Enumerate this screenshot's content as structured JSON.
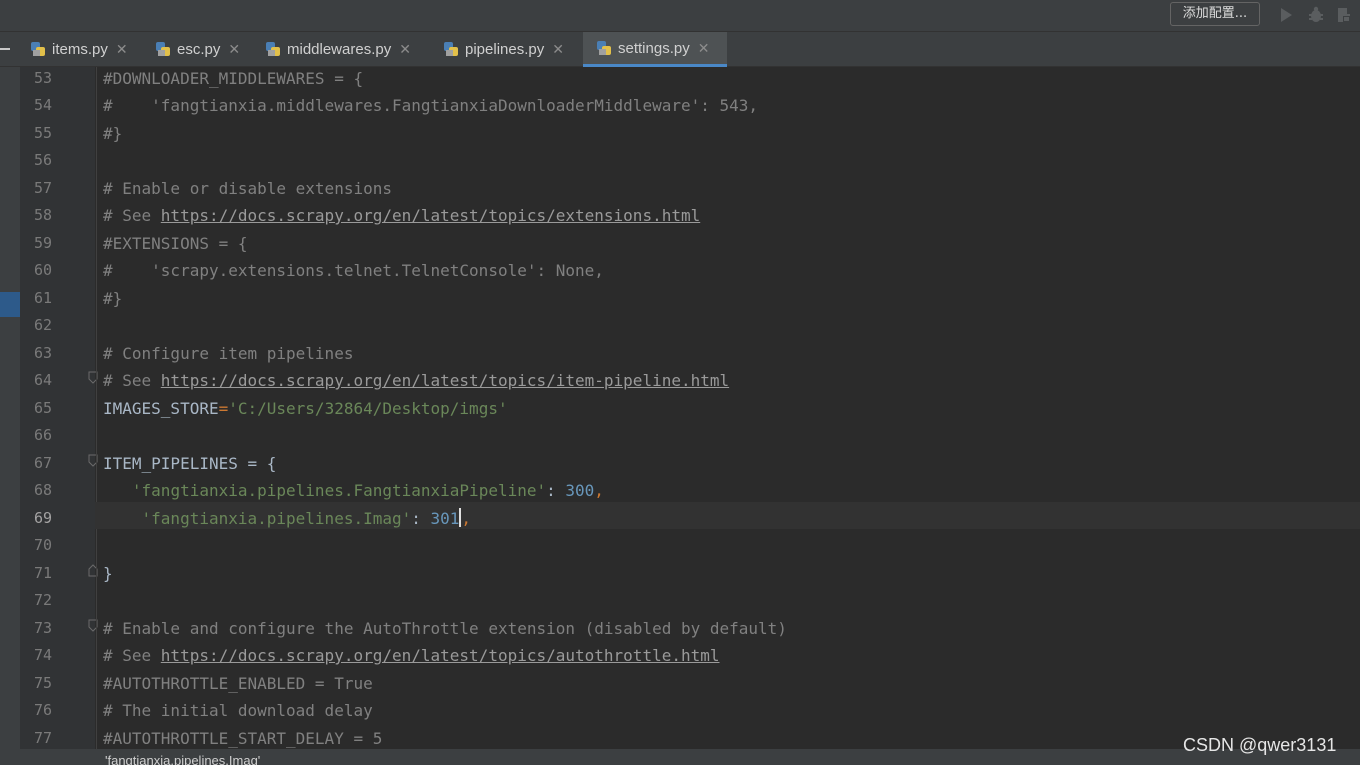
{
  "toolbar": {
    "config_button": "添加配置...",
    "icons": [
      "run-icon",
      "debug-icon",
      "coverage-icon"
    ]
  },
  "tabs": [
    {
      "label": "items.py",
      "active": false
    },
    {
      "label": "esc.py",
      "active": false
    },
    {
      "label": "middlewares.py",
      "active": false
    },
    {
      "label": "pipelines.py",
      "active": false
    },
    {
      "label": "settings.py",
      "active": true
    }
  ],
  "editor": {
    "current_line": "69",
    "lines": [
      {
        "n": "53",
        "code": "#DOWNLOADER_MIDDLEWARES = {"
      },
      {
        "n": "54",
        "code": "#    'fangtianxia.middlewares.FangtianxiaDownloaderMiddleware': 543,"
      },
      {
        "n": "55",
        "code": "#}"
      },
      {
        "n": "56",
        "code": ""
      },
      {
        "n": "57",
        "code": "# Enable or disable extensions"
      },
      {
        "n": "58",
        "code": "# See https://docs.scrapy.org/en/latest/topics/extensions.html"
      },
      {
        "n": "59",
        "code": "#EXTENSIONS = {"
      },
      {
        "n": "60",
        "code": "#    'scrapy.extensions.telnet.TelnetConsole': None,"
      },
      {
        "n": "61",
        "code": "#}"
      },
      {
        "n": "62",
        "code": ""
      },
      {
        "n": "63",
        "code": "# Configure item pipelines"
      },
      {
        "n": "64",
        "code": "# See https://docs.scrapy.org/en/latest/topics/item-pipeline.html"
      },
      {
        "n": "65",
        "code": "IMAGES_STORE='C:/Users/32864/Desktop/imgs'"
      },
      {
        "n": "66",
        "code": ""
      },
      {
        "n": "67",
        "code": "ITEM_PIPELINES = {"
      },
      {
        "n": "68",
        "code": "   'fangtianxia.pipelines.FangtianxiaPipeline': 300,"
      },
      {
        "n": "69",
        "code": "    'fangtianxia.pipelines.Imag': 301,"
      },
      {
        "n": "70",
        "code": ""
      },
      {
        "n": "71",
        "code": "}"
      },
      {
        "n": "72",
        "code": ""
      },
      {
        "n": "73",
        "code": "# Enable and configure the AutoThrottle extension (disabled by default)"
      },
      {
        "n": "74",
        "code": "# See https://docs.scrapy.org/en/latest/topics/autothrottle.html"
      },
      {
        "n": "75",
        "code": "#AUTOTHROTTLE_ENABLED = True"
      },
      {
        "n": "76",
        "code": "# The initial download delay"
      },
      {
        "n": "77",
        "code": "#AUTOTHROTTLE_START_DELAY = 5"
      }
    ]
  },
  "bottom_hint": "'fangtianxia.pipelines.Imag'",
  "watermark": "CSDN @qwer3131",
  "colors": {
    "background": "#2b2b2b",
    "comment": "#808080",
    "string": "#6a8759",
    "number": "#6897bb",
    "punctuation": "#cc7832",
    "default": "#a9b7c6",
    "active_tab_underline": "#4a88c7"
  }
}
